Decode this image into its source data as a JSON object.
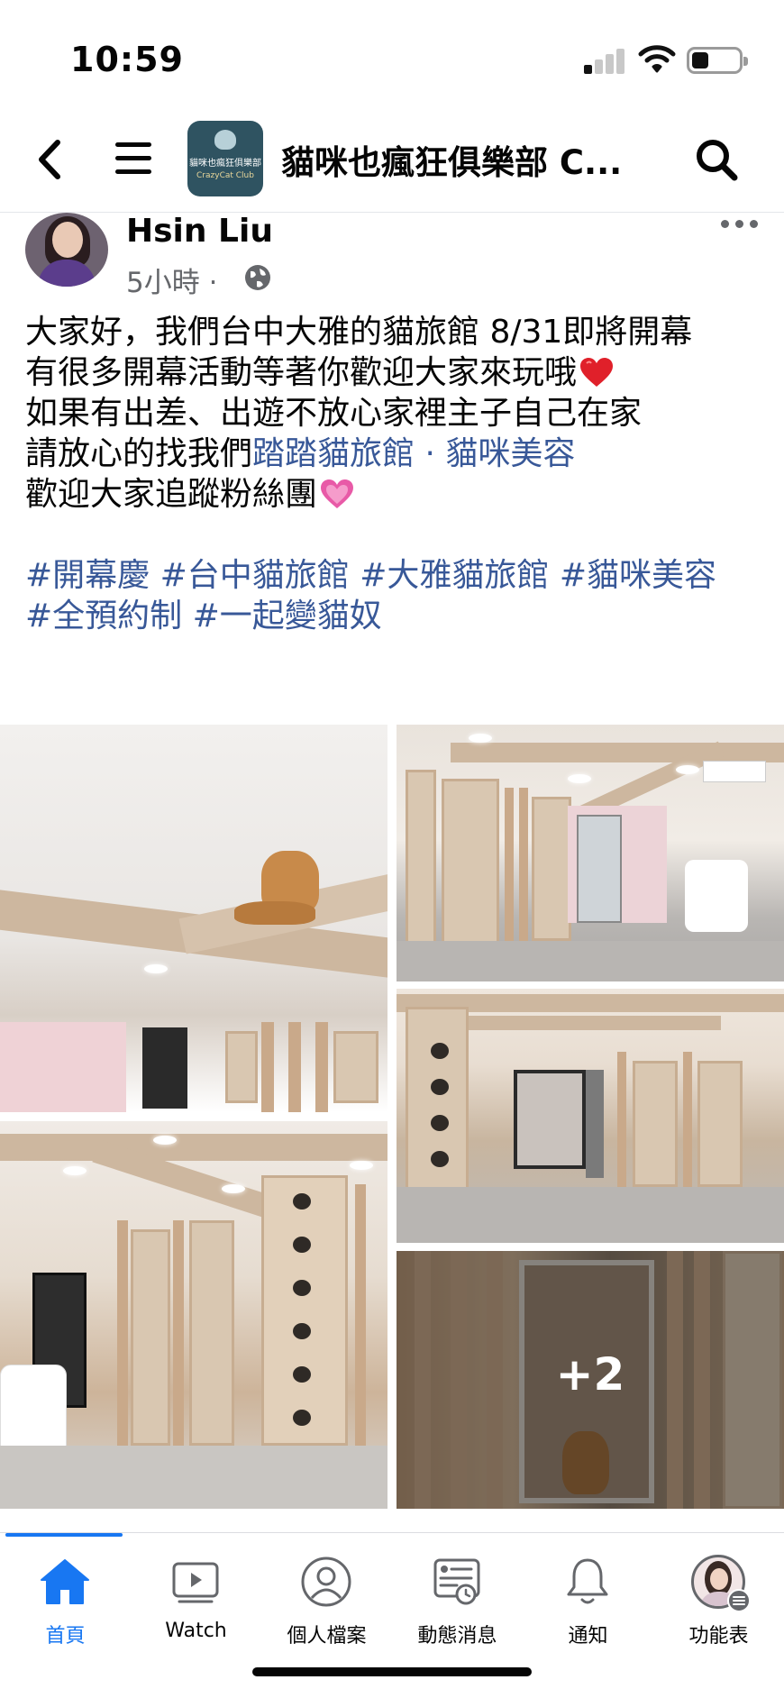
{
  "status_bar": {
    "time": "10:59"
  },
  "header": {
    "group_title": "貓咪也瘋狂俱樂部 C...",
    "group_logo_text": "貓咪也瘋狂俱樂部",
    "group_logo_sub": "CrazyCat Club"
  },
  "post": {
    "author": "Hsin Liu",
    "time": "5小時",
    "separator": " · ",
    "lines": [
      "大家好，我們台中大雅的貓旅館 8/31即將開幕",
      "有很多開幕活動等著你歡迎大家來玩哦",
      "如果有出差、出遊不放心家裡主子自己在家",
      "請放心的找我們",
      "歡迎大家追蹤粉絲團"
    ],
    "page_link": "踏踏貓旅館 · 貓咪美容",
    "hashtags_line1": "#開幕慶 #台中貓旅館 #大雅貓旅館 #貓咪美容",
    "hashtags_line2": "#全預約制 #一起變貓奴",
    "more_photos": "+2"
  },
  "tabs": [
    {
      "label": "首頁",
      "icon": "home-icon",
      "active": true
    },
    {
      "label": "Watch",
      "icon": "watch-icon",
      "active": false
    },
    {
      "label": "個人檔案",
      "icon": "profile-icon",
      "active": false
    },
    {
      "label": "動態消息",
      "icon": "news-feed-icon",
      "active": false
    },
    {
      "label": "通知",
      "icon": "bell-icon",
      "active": false
    },
    {
      "label": "功能表",
      "icon": "menu-avatar-icon",
      "active": false
    }
  ],
  "colors": {
    "accent": "#1877f2",
    "link": "#385898",
    "secondary_text": "#65676b"
  }
}
